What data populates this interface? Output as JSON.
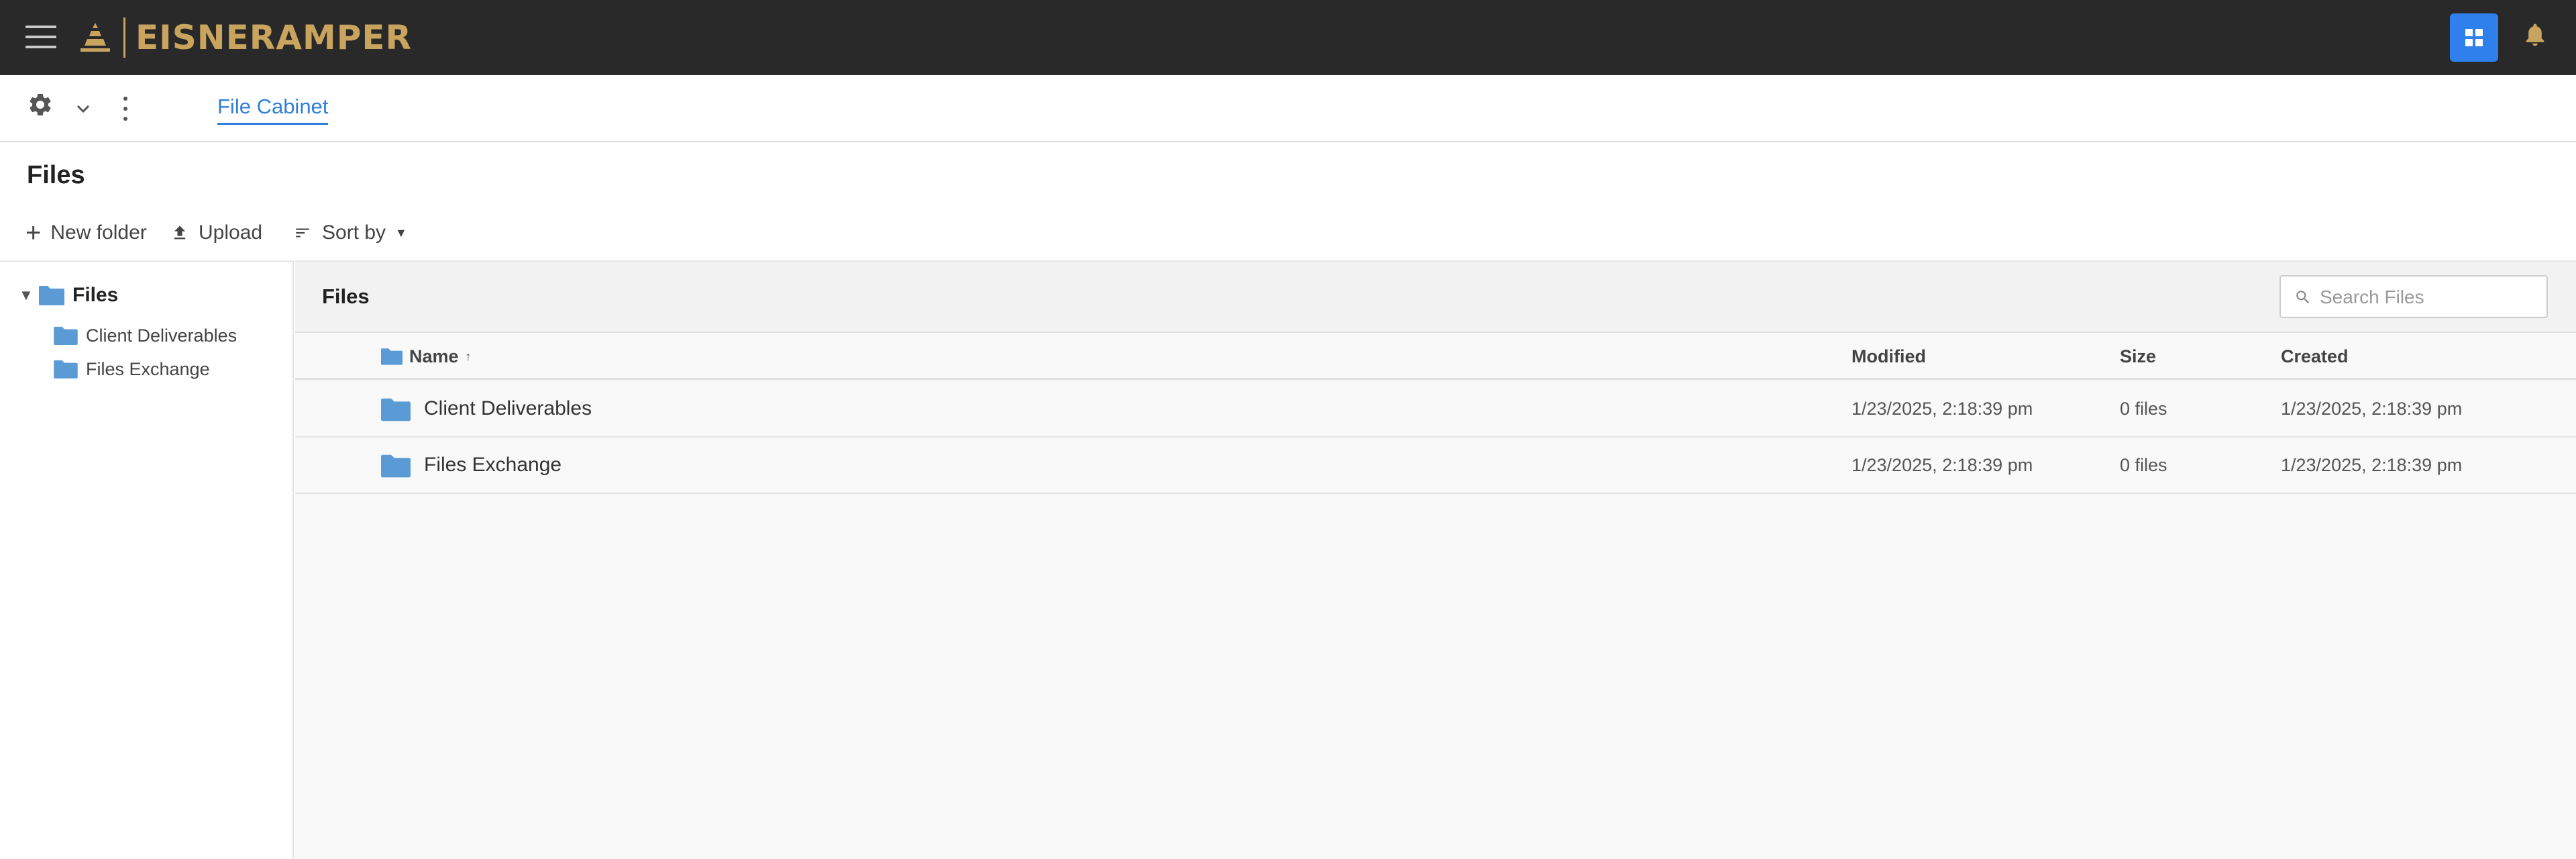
{
  "topbar": {
    "brand": "EISNERAMPER",
    "menu_icon": "hamburger-menu-icon",
    "apps_icon": "apps-grid-icon",
    "notifications_icon": "bell-icon",
    "accent_color": "#2f80ed",
    "brand_color": "#c9a45f",
    "background_color": "#292929"
  },
  "subbar": {
    "settings_icon": "gear-icon",
    "dropdown_icon": "chevron-down-icon",
    "more_icon": "kebab-menu-icon",
    "active_tab": "File Cabinet"
  },
  "page": {
    "title": "Files"
  },
  "actions": {
    "new_folder": "New folder",
    "upload": "Upload",
    "sort_by": "Sort by"
  },
  "tree": {
    "root": "Files",
    "items": [
      {
        "label": "Client Deliverables"
      },
      {
        "label": "Files Exchange"
      }
    ]
  },
  "main": {
    "title": "Files",
    "search": {
      "placeholder": "Search Files",
      "value": ""
    },
    "columns": {
      "name": "Name",
      "modified": "Modified",
      "size": "Size",
      "created": "Created"
    },
    "sort": {
      "column": "Name",
      "direction": "ascending",
      "indicator": "↑"
    },
    "rows": [
      {
        "name": "Client Deliverables",
        "modified": "1/23/2025, 2:18:39 pm",
        "size": "0 files",
        "created": "1/23/2025, 2:18:39 pm"
      },
      {
        "name": "Files Exchange",
        "modified": "1/23/2025, 2:18:39 pm",
        "size": "0 files",
        "created": "1/23/2025, 2:18:39 pm"
      }
    ]
  },
  "colors": {
    "folder": "#5b9bd5",
    "link": "#2f7fd8"
  }
}
